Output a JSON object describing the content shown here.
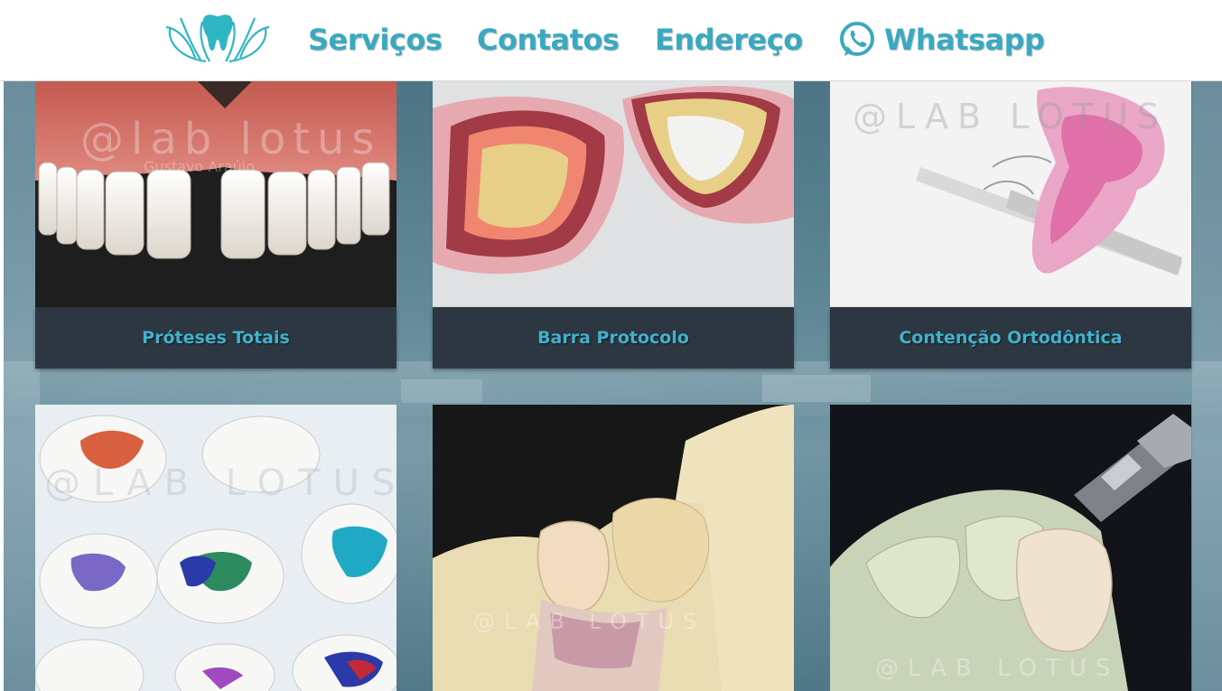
{
  "nav": {
    "links": [
      {
        "label": "Serviços"
      },
      {
        "label": "Contatos"
      },
      {
        "label": "Endereço"
      },
      {
        "label": "Whatsapp"
      }
    ],
    "accent_color": "#3aa9c0",
    "logo_icon": "lotus-tooth-logo",
    "whatsapp_icon": "whatsapp-icon"
  },
  "services": [
    {
      "title": "Próteses Totais",
      "watermark": "@lab lotus",
      "watermark_sub": "Gustavo Araújo",
      "image": "denture-photo"
    },
    {
      "title": "Barra Protocolo",
      "watermark": "",
      "image": "impression-molds-photo"
    },
    {
      "title": "Contenção Ortodôntica",
      "watermark": "@LAB LOTUS",
      "image": "orthodontic-retainer-photo"
    },
    {
      "title": "",
      "watermark": "@LAB LOTUS",
      "image": "orthodontic-appliances-photo"
    },
    {
      "title": "",
      "watermark": "@LAB LOTUS",
      "image": "ceramic-crown-photo"
    },
    {
      "title": "",
      "watermark": "@LAB LOTUS",
      "image": "crown-polishing-photo"
    }
  ],
  "colors": {
    "caption_bg": "#2d3742",
    "caption_text": "#3fb3cc",
    "page_bg": "#5b8493"
  }
}
